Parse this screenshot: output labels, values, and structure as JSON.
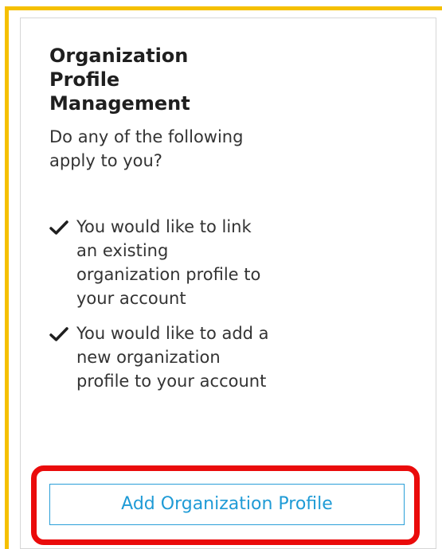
{
  "card": {
    "title": "Organization Profile Management",
    "intro": "Do any of the following apply to you?",
    "criteria": [
      {
        "icon": "checkmark-icon",
        "text": "You would like to link an existing organization profile to your account"
      },
      {
        "icon": "checkmark-icon",
        "text": "You would like to add a new organization profile to your account"
      }
    ],
    "add_button_label": "Add Organization Profile"
  },
  "colors": {
    "accent": "#1f9bd6",
    "highlight_frame": "#f5c000",
    "annotation_box": "#ea0b0b",
    "text": "#333333"
  }
}
